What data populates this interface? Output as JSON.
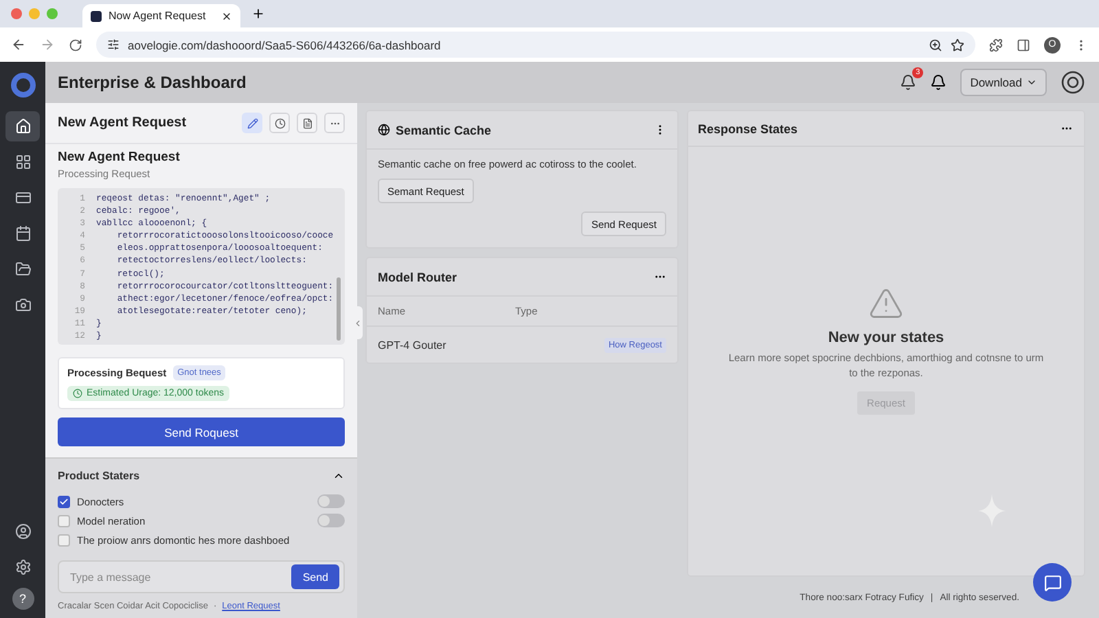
{
  "browser": {
    "tab_title": "Now Agent Request",
    "url": "aovelogie.com/dashooord/Saa5-S606/443266/6a-dashboard",
    "profile_initial": "O"
  },
  "header": {
    "title": "Enterprise & Dashboard",
    "notification_count": "3",
    "download_label": "Download"
  },
  "nav_items": [
    {
      "selected": true
    },
    {
      "selected": false
    },
    {
      "selected": false
    },
    {
      "selected": false
    },
    {
      "selected": false
    },
    {
      "selected": false
    }
  ],
  "nav_bottom": {
    "help_label": "?"
  },
  "left_panel": {
    "title": "New Agent Request",
    "tools": [
      {
        "kind": "edit",
        "selected": true
      },
      {
        "kind": "clock",
        "selected": false
      },
      {
        "kind": "doc",
        "selected": false
      },
      {
        "kind": "more",
        "selected": false
      }
    ],
    "form_title": "New Agent Request",
    "subtitle": "Processing Request",
    "code_lines": [
      {
        "n": "1",
        "text": "reqeost detas: \"renoennt\",Aget\" ;"
      },
      {
        "n": "2",
        "text": "cebalc: regooe',"
      },
      {
        "n": "3",
        "text": "vabllcc aloooenonl; {"
      },
      {
        "n": "4",
        "text": "    retorrrocoratictooosolonsltooicooso/cooce"
      },
      {
        "n": "5",
        "text": "    eleos.opprattosenpora/looosoaltoequent:"
      },
      {
        "n": "6",
        "text": "    retectoctorreslens/eollect/loolects:"
      },
      {
        "n": "7",
        "text": "    retocl();"
      },
      {
        "n": "8",
        "text": "    retorrrocorocourcator/cotltonsltteoguent:"
      },
      {
        "n": "9",
        "text": "    athect:egor/lecetoner/fenoce/eofrea/opct:"
      },
      {
        "n": "19",
        "text": "    atotlesegotate:reater/tetoter ceno);"
      },
      {
        "n": "11",
        "text": "}"
      },
      {
        "n": "12",
        "text": "}"
      }
    ],
    "status": {
      "title": "Processing Bequest",
      "tag": "Gnot tnees",
      "usage": "Estimated Urage: 12,000 tokens"
    },
    "send_button": "Send Roquest",
    "section": {
      "title": "Product Staters",
      "expanded": true,
      "items": [
        {
          "label": "Donocters",
          "checked": true,
          "kind": "toggle",
          "on": false
        },
        {
          "label": "Model neration",
          "checked": false,
          "kind": "toggle",
          "on": false
        },
        {
          "label": "The proiow anrs domontic hes more dashboed",
          "checked": false,
          "kind": "plain"
        }
      ]
    },
    "message": {
      "placeholder": "Type a message",
      "send": "Send"
    },
    "footer": {
      "text": "Cracalar Scen Coidar Acit Copociclise",
      "separator": "·",
      "link": "Leont Request"
    }
  },
  "semantic_cache": {
    "title": "Semantic Cache",
    "text": "Semantic cache on free powerd ac cotiross to the coolet.",
    "buttons": [
      "Semant Request",
      "Send Request"
    ]
  },
  "model_router": {
    "title": "Model Router",
    "columns": [
      "Name",
      "Type"
    ],
    "rows": [
      {
        "name": "GPT-4 Gouter",
        "tag": "How Regeost"
      }
    ]
  },
  "response_states": {
    "title": "Response States",
    "empty_title": "New your states",
    "empty_text": "Learn more sopet spocrine dechbions, amorthiog and cotnsne to urm to the rezponas.",
    "button": {
      "label": "Request",
      "disabled": true
    }
  },
  "page_footer": {
    "left": "Thore noo:sarx Fotracy Fuficy",
    "separator": "|",
    "right": "All righto seserved."
  }
}
